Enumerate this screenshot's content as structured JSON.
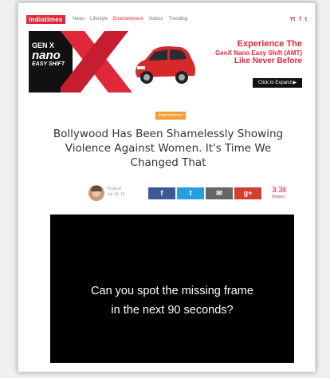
{
  "nav": {
    "logo": "indiatimes",
    "links": [
      "News",
      "Lifestyle",
      "Entertainment",
      "Videos",
      "Trending"
    ],
    "social": [
      "Yt",
      "f",
      "t"
    ]
  },
  "ad": {
    "brand_line1": "GEN X",
    "brand_line2": "nano",
    "brand_line3": "EASY SHIFT",
    "headline1": "Experience The",
    "headline2": "GenX Nano Easy Shift (AMT)",
    "headline3": "Like Never Before",
    "cta": "Click to Expand ▶",
    "colors": {
      "accent": "#e0283a",
      "car": "#d62a2a"
    }
  },
  "article": {
    "category": "Entertainment",
    "headline": "Bollywood Has Been Shamelessly Showing Violence Against Women. It's Time We Changed That",
    "author_name": "Prakruti",
    "author_meta": "Jul 14, 15",
    "share_icons": [
      "f",
      "t",
      "✉",
      "g+"
    ],
    "share_count": "3.3k",
    "share_label": "Shares"
  },
  "video": {
    "caption_line1": "Can you spot the missing frame",
    "caption_line2": "in the next 90 seconds?"
  }
}
